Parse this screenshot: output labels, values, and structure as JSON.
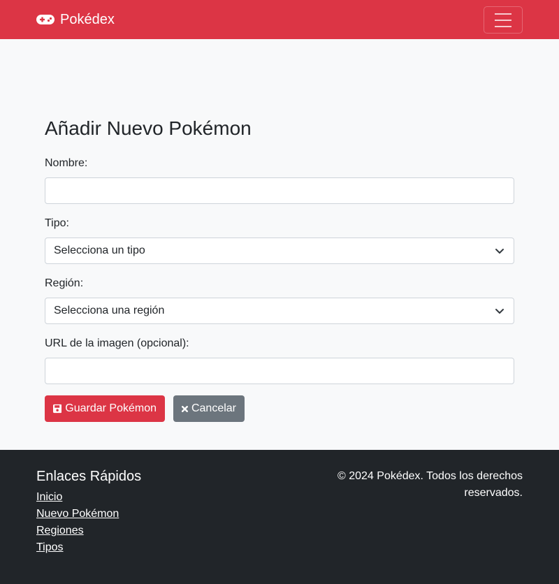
{
  "navbar": {
    "brand": "Pokédex",
    "brand_icon": "gamepad-icon",
    "menu_icon": "hamburger-menu-icon",
    "color": "#dc3545"
  },
  "form": {
    "title": "Añadir Nuevo Pokémon",
    "name_label": "Nombre:",
    "name_value": "",
    "type_label": "Tipo:",
    "type_selected": "Selecciona un tipo",
    "region_label": "Región:",
    "region_selected": "Selecciona una región",
    "image_label": "URL de la imagen (opcional):",
    "image_value": "",
    "save_label": "Guardar Pokémon",
    "save_icon": "floppy-disk-icon",
    "cancel_label": "Cancelar",
    "cancel_icon": "x-icon"
  },
  "footer": {
    "heading": "Enlaces Rápidos",
    "links": [
      "Inicio",
      "Nuevo Pokémon",
      "Regiones",
      "Tipos"
    ],
    "copyright": "© 2024 Pokédex. Todos los derechos reservados."
  },
  "colors": {
    "primary": "#dc3545",
    "secondary": "#6c757d",
    "dark": "#212529",
    "background": "#f8f9fa"
  }
}
